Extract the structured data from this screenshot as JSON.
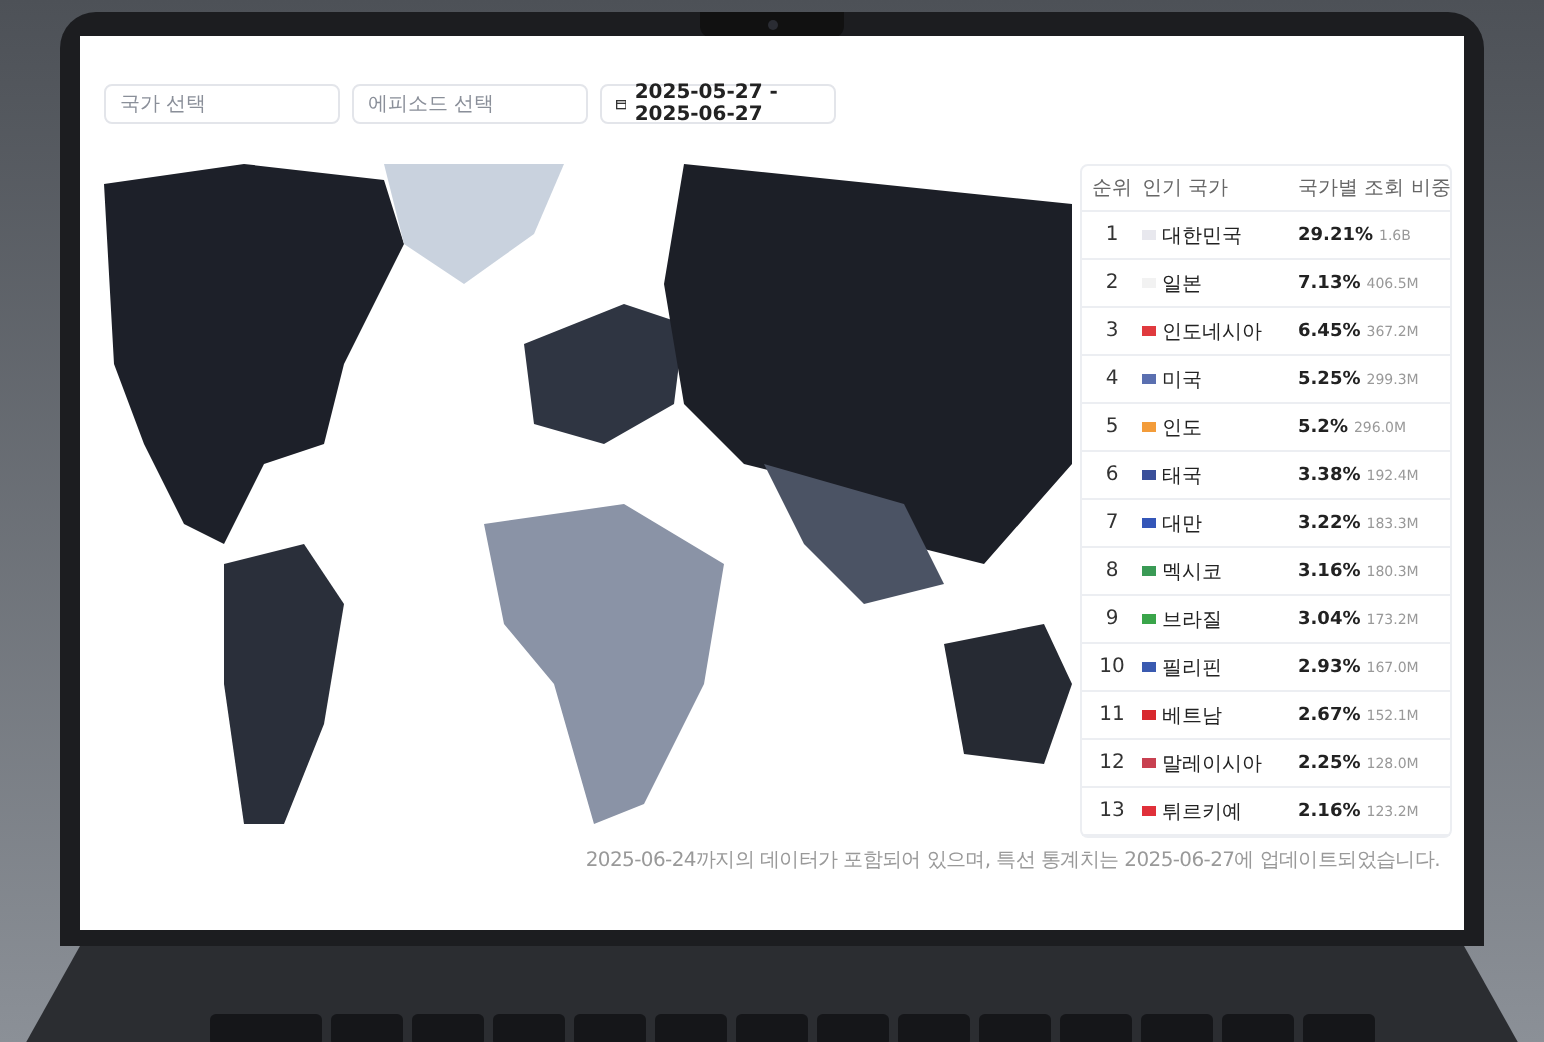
{
  "filters": {
    "country": {
      "placeholder": "국가 선택"
    },
    "episode": {
      "placeholder": "에피소드 선택"
    },
    "date_range": {
      "value": "2025-05-27 - 2025-06-27"
    }
  },
  "table": {
    "columns": [
      "순위",
      "인기 국가",
      "국가별 조회 비중"
    ],
    "rows": [
      {
        "rank": "1",
        "country": "대한민국",
        "share": "29.21%",
        "views": "1.6B",
        "color": "#e8e8ee"
      },
      {
        "rank": "2",
        "country": "일본",
        "share": "7.13%",
        "views": "406.5M",
        "color": "#f2f2f2"
      },
      {
        "rank": "3",
        "country": "인도네시아",
        "share": "6.45%",
        "views": "367.2M",
        "color": "#e03a3e"
      },
      {
        "rank": "4",
        "country": "미국",
        "share": "5.25%",
        "views": "299.3M",
        "color": "#5a6fb0"
      },
      {
        "rank": "5",
        "country": "인도",
        "share": "5.2%",
        "views": "296.0M",
        "color": "#f39c3a"
      },
      {
        "rank": "6",
        "country": "태국",
        "share": "3.38%",
        "views": "192.4M",
        "color": "#3a4f9a"
      },
      {
        "rank": "7",
        "country": "대만",
        "share": "3.22%",
        "views": "183.3M",
        "color": "#3456b8"
      },
      {
        "rank": "8",
        "country": "멕시코",
        "share": "3.16%",
        "views": "180.3M",
        "color": "#3a9a55"
      },
      {
        "rank": "9",
        "country": "브라질",
        "share": "3.04%",
        "views": "173.2M",
        "color": "#3aa54a"
      },
      {
        "rank": "10",
        "country": "필리핀",
        "share": "2.93%",
        "views": "167.0M",
        "color": "#3a5ab0"
      },
      {
        "rank": "11",
        "country": "베트남",
        "share": "2.67%",
        "views": "152.1M",
        "color": "#d8282e"
      },
      {
        "rank": "12",
        "country": "말레이시아",
        "share": "2.25%",
        "views": "128.0M",
        "color": "#c84050"
      },
      {
        "rank": "13",
        "country": "튀르키예",
        "share": "2.16%",
        "views": "123.2M",
        "color": "#e0303a"
      }
    ]
  },
  "footnote": "2025-06-24까지의 데이터가 포함되어 있으며, 특선 통계치는 2025-06-27에 업데이트되었습니다."
}
